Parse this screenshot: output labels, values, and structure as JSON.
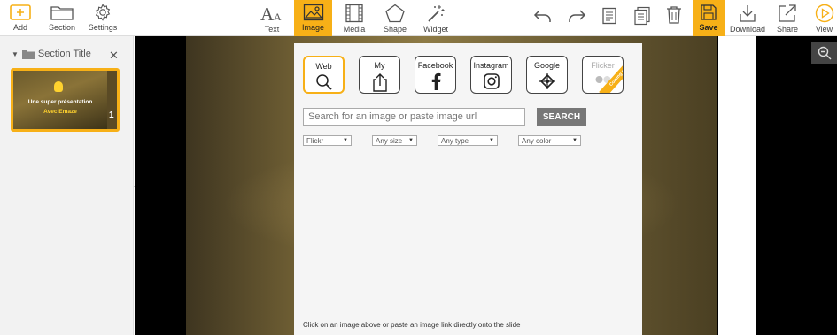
{
  "toolbar": {
    "add": "Add",
    "section": "Section",
    "settings": "Settings",
    "text": "Text",
    "image": "Image",
    "media": "Media",
    "shape": "Shape",
    "widget": "Widget",
    "save": "Save",
    "download": "Download",
    "share": "Share",
    "view": "View"
  },
  "sidebar": {
    "section_title": "Section Title",
    "slide": {
      "title": "Une super présentation",
      "subtitle": "Avec Emaze",
      "number": "1"
    }
  },
  "image_panel": {
    "sources": [
      {
        "label": "Web",
        "icon": "search-icon",
        "selected": true
      },
      {
        "label": "My",
        "icon": "upload-icon",
        "selected": false
      },
      {
        "label": "Facebook",
        "icon": "facebook-icon",
        "selected": false
      },
      {
        "label": "Instagram",
        "icon": "instagram-icon",
        "selected": false
      },
      {
        "label": "Google",
        "icon": "google-icon",
        "selected": false
      },
      {
        "label": "Flicker",
        "icon": "flickr-icon",
        "selected": false,
        "badge": "Coming soon"
      }
    ],
    "search_placeholder": "Search for an image or paste image url",
    "search_button": "SEARCH",
    "filters": {
      "provider": "Flickr",
      "size": "Any size",
      "type": "Any type",
      "color": "Any color"
    },
    "hint": "Click on an image above or paste an image link directly onto the slide"
  },
  "colors": {
    "accent": "#f7b017",
    "search_button": "#777777"
  }
}
